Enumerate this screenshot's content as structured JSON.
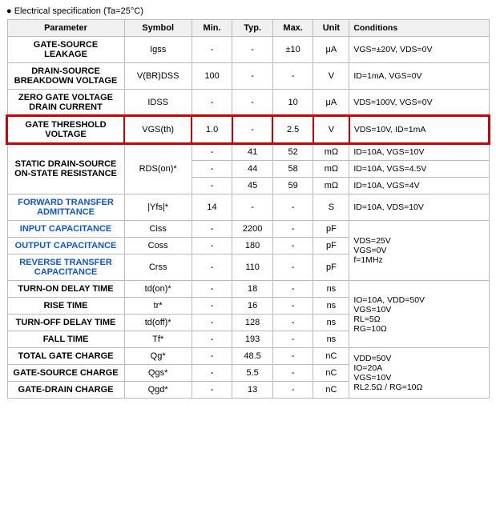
{
  "title": "● Electrical specification (Ta=25°C)",
  "table": {
    "headers": [
      "Parameter",
      "Symbol",
      "Min.",
      "Typ.",
      "Max.",
      "Unit",
      "Conditions"
    ],
    "rows": [
      {
        "param": "GATE-SOURCE LEAKAGE",
        "param_color": "normal",
        "symbol": "Igss",
        "min": "-",
        "typ": "-",
        "max": "±10",
        "unit": "μA",
        "conditions": "VGS=±20V, VDS=0V",
        "highlight": false,
        "rowspan": 1
      },
      {
        "param": "DRAIN-SOURCE BREAKDOWN VOLTAGE",
        "param_color": "normal",
        "symbol": "V(BR)DSS",
        "min": "100",
        "typ": "-",
        "max": "-",
        "unit": "V",
        "conditions": "ID=1mA, VGS=0V",
        "highlight": false,
        "rowspan": 1
      },
      {
        "param": "ZERO GATE VOLTAGE DRAIN CURRENT",
        "param_color": "normal",
        "symbol": "IDSS",
        "min": "-",
        "typ": "-",
        "max": "10",
        "unit": "μA",
        "conditions": "VDS=100V, VGS=0V",
        "highlight": false,
        "rowspan": 1
      },
      {
        "param": "GATE THRESHOLD VOLTAGE",
        "param_color": "normal",
        "symbol": "VGS(th)",
        "min": "1.0",
        "typ": "-",
        "max": "2.5",
        "unit": "V",
        "conditions": "VDS=10V, ID=1mA",
        "highlight": true,
        "rowspan": 1
      },
      {
        "param": "STATIC DRAIN-SOURCE ON-STATE RESISTANCE",
        "param_color": "normal",
        "symbol": "RDS(on)*",
        "rows_data": [
          {
            "min": "-",
            "typ": "41",
            "max": "52",
            "unit": "mΩ",
            "conditions": "ID=10A, VGS=10V"
          },
          {
            "min": "-",
            "typ": "44",
            "max": "58",
            "unit": "mΩ",
            "conditions": "ID=10A, VGS=4.5V"
          },
          {
            "min": "-",
            "typ": "45",
            "max": "59",
            "unit": "mΩ",
            "conditions": "ID=10A, VGS=4V"
          }
        ],
        "multirow": true,
        "highlight": false
      },
      {
        "param": "FORWARD TRANSFER ADMITTANCE",
        "param_color": "blue",
        "symbol": "|Yfs|*",
        "min": "14",
        "typ": "-",
        "max": "-",
        "unit": "S",
        "conditions": "ID=10A, VDS=10V",
        "highlight": false,
        "rowspan": 1
      },
      {
        "param": "INPUT CAPACITANCE",
        "param_color": "blue",
        "symbol": "Ciss",
        "min": "-",
        "typ": "2200",
        "max": "-",
        "unit": "pF",
        "conditions": "",
        "highlight": false,
        "rowspan": 1,
        "conditions_shared": true
      },
      {
        "param": "OUTPUT CAPACITANCE",
        "param_color": "blue",
        "symbol": "Coss",
        "min": "-",
        "typ": "180",
        "max": "-",
        "unit": "pF",
        "conditions": "",
        "highlight": false,
        "rowspan": 1,
        "conditions_shared": true
      },
      {
        "param": "REVERSE TRANSFER CAPACITANCE",
        "param_color": "blue",
        "symbol": "Crss",
        "min": "-",
        "typ": "110",
        "max": "-",
        "unit": "pF",
        "conditions": "",
        "highlight": false,
        "rowspan": 1,
        "conditions_shared": true
      },
      {
        "param": "TURN-ON DELAY TIME",
        "param_color": "normal",
        "symbol": "td(on)*",
        "min": "-",
        "typ": "18",
        "max": "-",
        "unit": "ns",
        "conditions": "",
        "highlight": false,
        "conditions_shared2": true
      },
      {
        "param": "RISE TIME",
        "param_color": "normal",
        "symbol": "tr*",
        "min": "-",
        "typ": "16",
        "max": "-",
        "unit": "ns",
        "conditions": "",
        "highlight": false,
        "conditions_shared2": true
      },
      {
        "param": "TURN-OFF DELAY TIME",
        "param_color": "normal",
        "symbol": "td(off)*",
        "min": "-",
        "typ": "128",
        "max": "-",
        "unit": "ns",
        "conditions": "",
        "highlight": false,
        "conditions_shared2": true
      },
      {
        "param": "FALL TIME",
        "param_color": "normal",
        "symbol": "Tf*",
        "min": "-",
        "typ": "193",
        "max": "-",
        "unit": "ns",
        "conditions": "",
        "highlight": false,
        "conditions_shared2": true
      },
      {
        "param": "TOTAL GATE CHARGE",
        "param_color": "normal",
        "symbol": "Qg*",
        "min": "-",
        "typ": "48.5",
        "max": "-",
        "unit": "nC",
        "conditions": "",
        "highlight": false,
        "conditions_shared3": true
      },
      {
        "param": "GATE-SOURCE CHARGE",
        "param_color": "normal",
        "symbol": "Qgs*",
        "min": "-",
        "typ": "5.5",
        "max": "-",
        "unit": "nC",
        "conditions": "",
        "highlight": false,
        "conditions_shared3": true
      },
      {
        "param": "GATE-DRAIN CHARGE",
        "param_color": "normal",
        "symbol": "Qgd*",
        "min": "-",
        "typ": "13",
        "max": "-",
        "unit": "nC",
        "conditions": "",
        "highlight": false,
        "conditions_shared3": true
      }
    ],
    "conditions_cap": "VDS=25V\nVGS=0V\nf=1MHz",
    "conditions_switch": "IO=10A, VDD=50V\nVGS=10V\nRL=5Ω\nRG=10Ω",
    "conditions_charge": "VDD=50V\nIO=20A\nVGS=10V\nRL2.5Ω / RG=10Ω"
  }
}
